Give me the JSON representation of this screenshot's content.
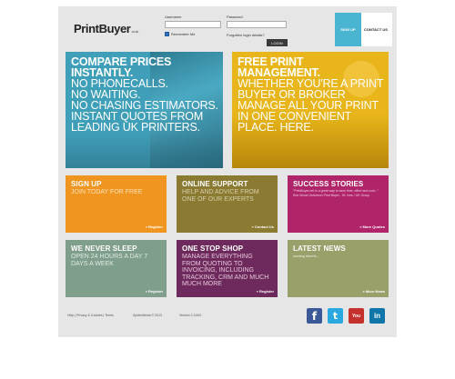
{
  "header": {
    "logo_main": "PrintBuyer",
    "logo_suffix": "co.uk",
    "username_label": "Username",
    "password_label": "Password",
    "remember_label": "Remember Me",
    "forgot_label": "Forgotten login details?",
    "login_button": "LOGIN",
    "signup_button": "SIGN UP",
    "contact_button": "CONTACT US"
  },
  "hero": {
    "left": {
      "headline": "COMPARE PRICES INSTANTLY.",
      "lines": [
        "NO PHONECALLS.",
        "NO WAITING.",
        "NO CHASING ESTIMATORS.",
        "INSTANT QUOTES FROM",
        "LEADING UK PRINTERS."
      ]
    },
    "right": {
      "headline": "FREE PRINT MANAGEMENT.",
      "lines": [
        "WHETHER YOU'RE A PRINT",
        "BUYER OR BROKER",
        "MANAGE ALL YOUR PRINT",
        "IN ONE CONVENIENT",
        "PLACE. HERE."
      ]
    }
  },
  "tiles": [
    {
      "title": "SIGN UP",
      "sub": "JOIN TODAY FOR FREE",
      "link": "» Register",
      "color": "#f0951f"
    },
    {
      "title": "ONLINE SUPPORT",
      "sub": "HELP AND ADVICE FROM ONE OF OUR EXPERTS",
      "link": "» Contact Us",
      "color": "#8a7a32"
    },
    {
      "title": "SUCCESS STORIES",
      "sub": "\"PrintBuyer.net is a great way to save time, effort and cost...\" Rob Wood Ushoreon Print Buyer - St. Ives / UK Group",
      "link": "» More Quotes",
      "color": "#b0246a"
    },
    {
      "title": "WE NEVER SLEEP",
      "sub": "OPEN 24 HOURS A DAY 7 DAYS A WEEK",
      "link": "» Register",
      "color": "#7f9e8c"
    },
    {
      "title": "ONE STOP SHOP",
      "sub": "MANAGE EVERYTHING FROM QUOTING TO INVOICING, INCLUDING TRACKING, CRM AND MUCH MUCH MORE",
      "link": "» Register",
      "color": "#6e2a5c"
    },
    {
      "title": "LATEST NEWS",
      "sub": "loading tweets...",
      "link": "» More News",
      "color": "#9aa06a"
    }
  ],
  "footer": {
    "links": "Help | Privacy & Cookies | Terms",
    "copyright": "SpiderMedia © 2013",
    "version": "Version 2.3.810"
  },
  "social": [
    {
      "name": "facebook",
      "glyph": "f",
      "color": "#3b5998"
    },
    {
      "name": "twitter",
      "glyph": "t",
      "color": "#2aa9e0"
    },
    {
      "name": "youtube",
      "glyph": "You",
      "color": "#c4302b"
    },
    {
      "name": "linkedin",
      "glyph": "in",
      "color": "#0e76a8"
    }
  ]
}
